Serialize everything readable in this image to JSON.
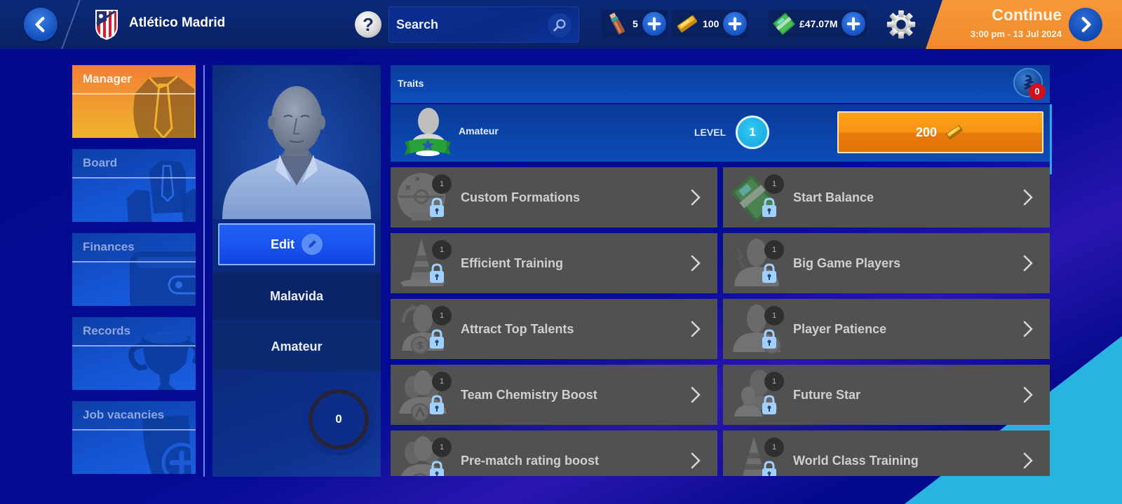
{
  "header": {
    "club_name": "Atlético Madrid",
    "help_label": "?",
    "search_placeholder": "Search",
    "currencies": [
      {
        "name": "energy-vial",
        "value": "5"
      },
      {
        "name": "gold-bar",
        "value": "100"
      },
      {
        "name": "cash",
        "value": "£47.07M"
      }
    ],
    "continue": {
      "label": "Continue",
      "datetime": "3:00 pm - 13 Jul 2024"
    }
  },
  "sidebar": {
    "items": [
      {
        "label": "Manager",
        "icon": "manager-tie-icon",
        "active": true
      },
      {
        "label": "Board",
        "icon": "board-members-icon",
        "active": false
      },
      {
        "label": "Finances",
        "icon": "wallet-icon",
        "active": false
      },
      {
        "label": "Records",
        "icon": "trophy-icon",
        "active": false
      },
      {
        "label": "Job vacancies",
        "icon": "job-add-icon",
        "active": false
      }
    ]
  },
  "profile": {
    "edit_label": "Edit",
    "name": "Malavida",
    "rank": "Amateur",
    "points": "0"
  },
  "traits": {
    "title": "Traits",
    "coin_count": "0",
    "rank_label": "Amateur",
    "level_label": "LEVEL",
    "level_value": "1",
    "unlock_cost": "200",
    "items": [
      {
        "name": "Custom Formations",
        "level": "1",
        "locked": true,
        "icon": "tactics-board"
      },
      {
        "name": "Start Balance",
        "level": "1",
        "locked": true,
        "icon": "cash"
      },
      {
        "name": "Efficient Training",
        "level": "1",
        "locked": true,
        "icon": "training-cone"
      },
      {
        "name": "Big Game Players",
        "level": "1",
        "locked": true,
        "icon": "player-lightning"
      },
      {
        "name": "Attract Top Talents",
        "level": "1",
        "locked": true,
        "icon": "player-money"
      },
      {
        "name": "Player Patience",
        "level": "1",
        "locked": true,
        "icon": "player-clock"
      },
      {
        "name": "Team Chemistry Boost",
        "level": "1",
        "locked": true,
        "icon": "team-network"
      },
      {
        "name": "Future Star",
        "level": "1",
        "locked": true,
        "icon": "young-player"
      },
      {
        "name": "Pre-match rating boost",
        "level": "1",
        "locked": true,
        "icon": "team-rating"
      },
      {
        "name": "World Class Training",
        "level": "1",
        "locked": true,
        "icon": "training-cone"
      }
    ]
  },
  "colors": {
    "accent_orange": "#f08a2a",
    "nav_blue": "#1556d4",
    "trait_row": "#515151",
    "level_cyan": "#1aaee6",
    "badge_red": "#d0121e"
  }
}
